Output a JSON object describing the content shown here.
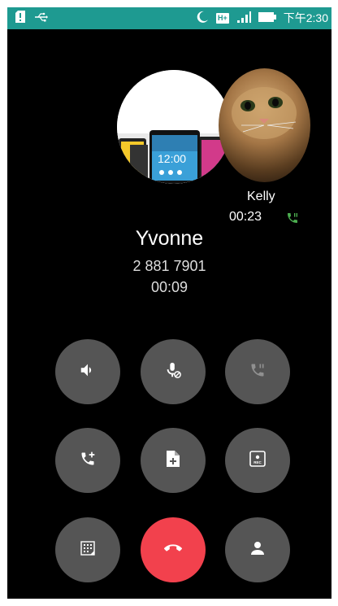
{
  "status_bar": {
    "time": "下午2:30",
    "network": "H+",
    "icons": [
      "sim-alert-icon",
      "usb-icon",
      "do-not-disturb-moon-icon",
      "h-plus-icon",
      "signal-icon",
      "battery-icon"
    ]
  },
  "held_call": {
    "name": "Kelly",
    "duration": "00:23",
    "status_icon": "call-on-hold-icon"
  },
  "active_call": {
    "name": "Yvonne",
    "number": "2 881 7901",
    "duration": "00:09"
  },
  "controls": [
    {
      "name": "speaker",
      "icon": "speaker-icon",
      "enabled": true
    },
    {
      "name": "mute",
      "icon": "mic-mute-icon",
      "enabled": true
    },
    {
      "name": "hold",
      "icon": "hold-call-icon",
      "enabled": false
    },
    {
      "name": "add-call",
      "icon": "add-call-icon",
      "enabled": true
    },
    {
      "name": "memo",
      "icon": "note-add-icon",
      "enabled": true
    },
    {
      "name": "record",
      "icon": "record-icon",
      "enabled": true,
      "label": "REC"
    },
    {
      "name": "dialpad",
      "icon": "dialpad-icon",
      "enabled": true
    },
    {
      "name": "end-call",
      "icon": "end-call-icon",
      "enabled": true
    },
    {
      "name": "contacts",
      "icon": "contact-icon",
      "enabled": true
    }
  ],
  "colors": {
    "status_bar": "#1e9a91",
    "background": "#000000",
    "button": "#555555",
    "end_call": "#f2414d",
    "hold_indicator": "#4caf50"
  }
}
